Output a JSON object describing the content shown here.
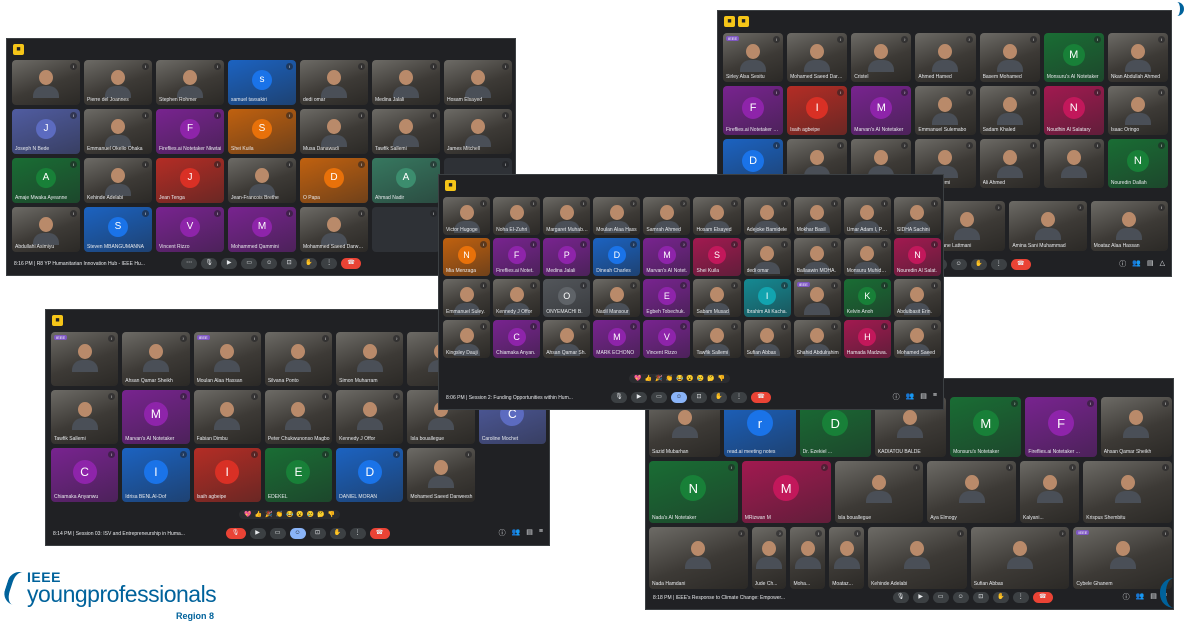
{
  "logo": {
    "brand": "IEEE",
    "wordmark": "youngprofessionals",
    "region": "Region 8"
  },
  "win1": {
    "footer": "8:16 PM  |  R8 YP Humanitarian Innovation Hub - IEEE Hu...",
    "tiles": [
      {
        "label": "",
        "kind": "photo"
      },
      {
        "label": "Pierre del Joannes",
        "kind": "photo"
      },
      {
        "label": "Stephen Rohmer",
        "kind": "photo"
      },
      {
        "label": "samuel tavsakiri",
        "kind": "letter",
        "letter": "s",
        "color": "#1a73e8"
      },
      {
        "label": "dedi omar",
        "kind": "photo"
      },
      {
        "label": "Medina Jalali",
        "kind": "photo"
      },
      {
        "label": "Hosam Elsayed",
        "kind": "photo"
      },
      {
        "label": "Joseph N Bede",
        "kind": "letter",
        "letter": "J",
        "color": "#5c6bc0"
      },
      {
        "label": "Emmanuel Okello Ohaka",
        "kind": "photo"
      },
      {
        "label": "Fireflies.ai Notetaker Nkwtai",
        "kind": "letter",
        "letter": "F",
        "color": "#8e24aa"
      },
      {
        "label": "Shei Kuila",
        "kind": "letter",
        "letter": "S",
        "color": "#e8710a"
      },
      {
        "label": "Musa Danawadi",
        "kind": "photo"
      },
      {
        "label": "Tawfik Sallemi",
        "kind": "photo"
      },
      {
        "label": "James Mitchell",
        "kind": "photo"
      },
      {
        "label": "Amaje Mwaka Ayeanne",
        "kind": "letter",
        "letter": "A",
        "color": "#188038"
      },
      {
        "label": "Kehinde Adelabi",
        "kind": "photo"
      },
      {
        "label": "Jean Tenga",
        "kind": "letter",
        "letter": "J",
        "color": "#d93025"
      },
      {
        "label": "Jean-Francois Brethe",
        "kind": "photo"
      },
      {
        "label": "O Papa",
        "kind": "letter",
        "letter": "D",
        "color": "#e8710a"
      },
      {
        "label": "Ahmad Nadir",
        "kind": "letter",
        "letter": "A",
        "color": "#3c8d6e"
      },
      {
        "label": "",
        "kind": "dark"
      },
      {
        "label": "Abdullahi Asimiyu",
        "kind": "photo"
      },
      {
        "label": "Steven MBANGUMANNA",
        "kind": "letter",
        "letter": "S",
        "color": "#1a73e8"
      },
      {
        "label": "Vincent Rizzo",
        "kind": "letter",
        "letter": "V",
        "color": "#8e24aa"
      },
      {
        "label": "Mohammed Qammini",
        "kind": "letter",
        "letter": "M",
        "color": "#8e24aa"
      },
      {
        "label": "Mohammed Saeed Darweesh",
        "kind": "photo"
      },
      {
        "label": "",
        "kind": "dark"
      },
      {
        "label": "",
        "kind": "dark"
      }
    ]
  },
  "win2": {
    "tiles": [
      {
        "label": "Sirley Alsa Sesitu",
        "kind": "photo",
        "tag": "IEEE"
      },
      {
        "label": "Mohamed Saeed Darweesh",
        "kind": "photo"
      },
      {
        "label": "Cristel",
        "kind": "photo"
      },
      {
        "label": "Ahmed Hamed",
        "kind": "photo"
      },
      {
        "label": "Basem Mohamed",
        "kind": "photo"
      },
      {
        "label": "Monsuru's AI Notetaker",
        "kind": "letter",
        "letter": "M",
        "color": "#188038"
      },
      {
        "label": "Nkan Abdullah Ahmed",
        "kind": "photo"
      },
      {
        "label": "Fireflies.ai Notetaker Nkwtai",
        "kind": "letter",
        "letter": "F",
        "color": "#8e24aa"
      },
      {
        "label": "Isaih agbeipe",
        "kind": "letter",
        "letter": "I",
        "color": "#d93025"
      },
      {
        "label": "Marvan's AI Notetaker",
        "kind": "letter",
        "letter": "M",
        "color": "#8e24aa"
      },
      {
        "label": "Emmanuel Sulemabo",
        "kind": "photo"
      },
      {
        "label": "Sadam Khaled",
        "kind": "photo"
      },
      {
        "label": "Noudhin Al Salatary",
        "kind": "letter",
        "letter": "N",
        "color": "#c2185b"
      },
      {
        "label": "Isaac Oringo",
        "kind": "photo"
      },
      {
        "label": "",
        "kind": "letter",
        "letter": "D",
        "color": "#1a73e8"
      },
      {
        "label": "",
        "kind": "photo"
      },
      {
        "label": "",
        "kind": "photo"
      },
      {
        "label": "Tawfik Sallemi",
        "kind": "photo"
      },
      {
        "label": "Ali Ahmed",
        "kind": "photo"
      },
      {
        "label": "",
        "kind": "photo"
      },
      {
        "label": "Nouredin Dallah",
        "kind": "letter",
        "letter": "N",
        "color": "#188038"
      }
    ],
    "bottom": [
      {
        "label": "Hassane Lattmani",
        "kind": "photo"
      },
      {
        "label": "Amina Sani Muhammad",
        "kind": "photo"
      },
      {
        "label": "Moataz Alaa Hassan",
        "kind": "photo"
      }
    ]
  },
  "win3": {
    "footer": "8:06 PM  |  Session 2: Funding Opportunities within Hum...",
    "emojis": [
      "💖",
      "👍",
      "🎉",
      "👏",
      "😂",
      "😮",
      "😢",
      "🤔",
      "👎"
    ],
    "tiles": [
      {
        "label": "Victor Hugoge",
        "kind": "photo"
      },
      {
        "label": "Noha EI-Zuhri",
        "kind": "photo"
      },
      {
        "label": "Margaret Muhabba",
        "kind": "photo"
      },
      {
        "label": "Moulan Alaa Hass",
        "kind": "photo"
      },
      {
        "label": "Samrah Ahmed",
        "kind": "photo"
      },
      {
        "label": "Hosam Elsayed",
        "kind": "photo"
      },
      {
        "label": "Adejoke Bamidele",
        "kind": "photo"
      },
      {
        "label": "Mokhar Basil",
        "kind": "photo"
      },
      {
        "label": "Umar Adam I, Ph.D.",
        "kind": "photo"
      },
      {
        "label": "SIDHA Sachini",
        "kind": "photo"
      },
      {
        "label": "Mia Menzaga",
        "kind": "letter",
        "letter": "N",
        "color": "#e8710a"
      },
      {
        "label": "Fireflies.ai Notet.",
        "kind": "letter",
        "letter": "F",
        "color": "#8e24aa"
      },
      {
        "label": "Medina Jalali",
        "kind": "letter",
        "letter": "P",
        "color": "#8e24aa"
      },
      {
        "label": "Dineah Charles",
        "kind": "letter",
        "letter": "D",
        "color": "#1a73e8"
      },
      {
        "label": "Marvan's AI Notet.",
        "kind": "letter",
        "letter": "M",
        "color": "#8e24aa"
      },
      {
        "label": "Shei Kuila",
        "kind": "letter",
        "letter": "S",
        "color": "#c2185b"
      },
      {
        "label": "dedi omar",
        "kind": "photo"
      },
      {
        "label": "Ballaawin MOHA.",
        "kind": "photo"
      },
      {
        "label": "Monsuru Muhiddeen",
        "kind": "photo"
      },
      {
        "label": "Nouredin Al Salat.",
        "kind": "letter",
        "letter": "N",
        "color": "#c2185b"
      },
      {
        "label": "Emmanuel Suley.",
        "kind": "photo"
      },
      {
        "label": "Kennedy J Offor",
        "kind": "photo"
      },
      {
        "label": "ONYEMACHI B.",
        "kind": "letter",
        "letter": "O",
        "color": "#5f6368"
      },
      {
        "label": "Nadil Mansour",
        "kind": "photo"
      },
      {
        "label": "Egbeh Tobechuk.",
        "kind": "letter",
        "letter": "E",
        "color": "#8e24aa"
      },
      {
        "label": "Sabam Musad",
        "kind": "photo"
      },
      {
        "label": "Ibrahim Ali Kacha.",
        "kind": "letter",
        "letter": "I",
        "color": "#12a4af"
      },
      {
        "label": "",
        "kind": "photo",
        "tag": "IEEE"
      },
      {
        "label": "Kelvin Anoh",
        "kind": "letter",
        "letter": "K",
        "color": "#188038"
      },
      {
        "label": "Abdulbasit Erin.",
        "kind": "photo"
      },
      {
        "label": "Kingsley Dauji",
        "kind": "photo"
      },
      {
        "label": "Chiamaka Anyan.",
        "kind": "letter",
        "letter": "C",
        "color": "#8e24aa"
      },
      {
        "label": "Ahsan Qamar Sh.",
        "kind": "photo"
      },
      {
        "label": "MARK ECHONO",
        "kind": "letter",
        "letter": "M",
        "color": "#8e24aa"
      },
      {
        "label": "Vincent Rizzo",
        "kind": "letter",
        "letter": "V",
        "color": "#8e24aa"
      },
      {
        "label": "Tawfik Sallemi",
        "kind": "photo"
      },
      {
        "label": "Sufian Abbas",
        "kind": "photo"
      },
      {
        "label": "Shahid Abdulrahim",
        "kind": "photo"
      },
      {
        "label": "Hamada Madzwa.",
        "kind": "letter",
        "letter": "H",
        "color": "#c2185b"
      },
      {
        "label": "Mohamed Saeed",
        "kind": "photo"
      }
    ]
  },
  "win4": {
    "footer": "8:14 PM  |  Session 03: ISV and Entrepreneurship in Huma...",
    "emojis": [
      "💖",
      "👍",
      "🎉",
      "👏",
      "😂",
      "😮",
      "😢",
      "🤔",
      "👎"
    ],
    "tiles": [
      {
        "label": "",
        "kind": "photo",
        "tag": "IEEE"
      },
      {
        "label": "Ahsan Qamar Sheikh",
        "kind": "photo"
      },
      {
        "label": "Moulan Alaa Hassan",
        "kind": "photo",
        "tag": "IEEE"
      },
      {
        "label": "Silvana Ponto",
        "kind": "photo"
      },
      {
        "label": "Simon Muharram",
        "kind": "photo"
      },
      {
        "label": "",
        "kind": "photo"
      },
      {
        "label": "Fireflies.ai Notetaker Nkwtai",
        "kind": "letter",
        "letter": "F",
        "color": "#8e24aa"
      },
      {
        "label": "Tawfik Sallemi",
        "kind": "photo"
      },
      {
        "label": "Marvan's AI Notetaker",
        "kind": "letter",
        "letter": "M",
        "color": "#8e24aa"
      },
      {
        "label": "Fabian Dimbu",
        "kind": "photo"
      },
      {
        "label": "Peter Chukwunonso Magbo",
        "kind": "photo"
      },
      {
        "label": "Kennedy J Offor",
        "kind": "photo"
      },
      {
        "label": "Isla bouallegue",
        "kind": "photo"
      },
      {
        "label": "Caroline Mochet",
        "kind": "letter",
        "letter": "C",
        "color": "#5c6bc0"
      },
      {
        "label": "Chiamaka Anyanwu",
        "kind": "letter",
        "letter": "C",
        "color": "#8e24aa"
      },
      {
        "label": "Idrisa BENLAI-Dof",
        "kind": "letter",
        "letter": "I",
        "color": "#1a73e8"
      },
      {
        "label": "Isaih agbeipe",
        "kind": "letter",
        "letter": "I",
        "color": "#d93025"
      },
      {
        "label": "EDEKEL",
        "kind": "letter",
        "letter": "E",
        "color": "#188038"
      },
      {
        "label": "DANIEL MORAN",
        "kind": "letter",
        "letter": "D",
        "color": "#1a73e8"
      },
      {
        "label": "Mohamed Saeed Darweesh",
        "kind": "photo"
      }
    ]
  },
  "win5": {
    "footer": "8:18 PM  |  IEEE's Response to Climate Change: Empower...",
    "row1": [
      {
        "label": "Sazid Mubarhan",
        "kind": "photo"
      },
      {
        "label": "read.ai meeting notes",
        "kind": "letter",
        "letter": "r",
        "color": "#1a73e8"
      },
      {
        "label": "Dr. Ezekiel ...",
        "kind": "letter",
        "letter": "D",
        "color": "#188038"
      },
      {
        "label": "KADIATOU BALDE",
        "kind": "photo"
      },
      {
        "label": "Monsuru's Notetaker",
        "kind": "letter",
        "letter": "M",
        "color": "#188038"
      },
      {
        "label": "Fireflies.ai Notetaker ...",
        "kind": "letter",
        "letter": "F",
        "color": "#8e24aa"
      },
      {
        "label": "Ahsan Qamar Sheikh",
        "kind": "photo"
      }
    ],
    "row2": [
      {
        "label": "Nada's AI Notetaker",
        "kind": "letter",
        "letter": "N",
        "color": "#188038"
      },
      {
        "label": "MRizwan M",
        "kind": "letter",
        "letter": "M",
        "color": "#c2185b"
      },
      {
        "label": "Isla bouallegue",
        "kind": "photo"
      },
      {
        "label": "Aya Elmogy",
        "kind": "photo"
      },
      {
        "label": "Kalyani...",
        "kind": "photo"
      },
      {
        "label": "Krispus Shembitu",
        "kind": "photo"
      }
    ],
    "row3": [
      {
        "label": "Nada Hamdani",
        "kind": "photo"
      },
      {
        "label": "Jude Ch...",
        "kind": "photo"
      },
      {
        "label": "Moha...",
        "kind": "photo"
      },
      {
        "label": "Moataz...",
        "kind": "photo"
      },
      {
        "label": "Kehinde Adelabi",
        "kind": "photo"
      },
      {
        "label": "Sufian Abbas",
        "kind": "photo"
      },
      {
        "label": "Cybele Ghanem",
        "kind": "photo",
        "tag": "IEEE"
      }
    ]
  }
}
